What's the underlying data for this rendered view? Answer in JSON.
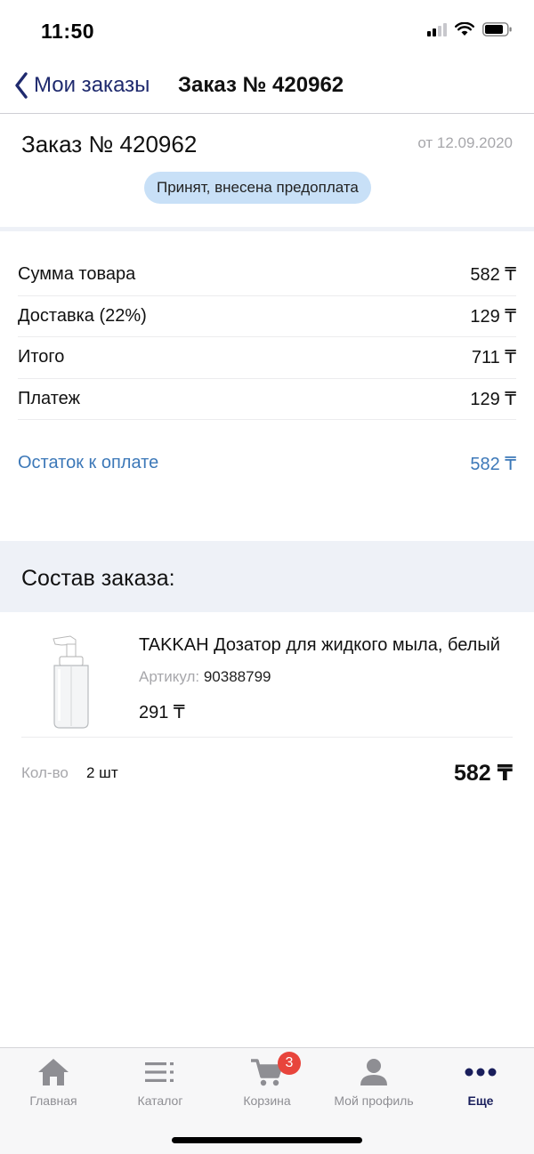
{
  "status_bar": {
    "time": "11:50"
  },
  "nav": {
    "back_label": "Мои заказы",
    "title": "Заказ № 420962"
  },
  "order": {
    "title": "Заказ № 420962",
    "date": "от 12.09.2020",
    "status": "Принят, внесена предоплата"
  },
  "summary": {
    "rows": [
      {
        "label": "Сумма товара",
        "value": "582 ₸"
      },
      {
        "label": "Доставка (22%)",
        "value": "129 ₸"
      },
      {
        "label": "Итого",
        "value": "711 ₸"
      },
      {
        "label": "Платеж",
        "value": "129 ₸"
      }
    ],
    "remainder_label": "Остаток к оплате",
    "remainder_value": "582 ₸"
  },
  "composition": {
    "title": "Состав заказа:",
    "items": [
      {
        "name": "TAKKAH Дозатор для жидкого мыла, белый",
        "sku_label": "Артикул:",
        "sku": "90388799",
        "price": "291 ₸",
        "qty_label": "Кол-во",
        "qty": "2 шт",
        "total": "582 ₸"
      }
    ]
  },
  "tab_bar": {
    "tabs": [
      {
        "label": "Главная",
        "icon": "home-icon"
      },
      {
        "label": "Каталог",
        "icon": "list-icon"
      },
      {
        "label": "Корзина",
        "icon": "cart-icon",
        "badge": "3"
      },
      {
        "label": "Мой профиль",
        "icon": "profile-icon"
      },
      {
        "label": "Еще",
        "icon": "more-icon",
        "active": true
      }
    ]
  },
  "colors": {
    "accent_dark": "#1a1f5c",
    "link_blue": "#3c78b8",
    "badge_blue": "#c8e0f7",
    "section_bg": "#eef1f7",
    "cart_badge": "#e8453c"
  }
}
